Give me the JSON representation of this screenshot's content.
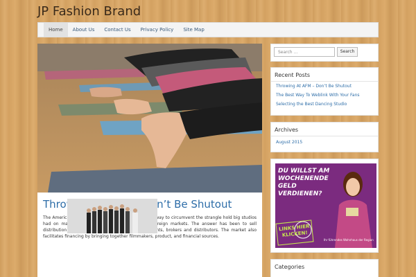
{
  "site": {
    "title": "JP Fashion Brand"
  },
  "nav": {
    "items": [
      "Home",
      "About Us",
      "Contact Us",
      "Privacy Policy",
      "Site Map"
    ],
    "active": "Home"
  },
  "post": {
    "title": "Throwing At AFM – Don’t Be Shutout",
    "body": "The American Film Market was founded in 1981 as a way to circumvent the strangle hold big studios had on marketing and distribution, especially in foreign markets. The answer has been to sell distribution rights directly to independent sales agents, brokers and distributors. The market also facilitates financing by bringing together filmmakers, product, and financial sources."
  },
  "search": {
    "placeholder": "Search …",
    "button": "Search"
  },
  "recent_posts": {
    "title": "Recent Posts",
    "items": [
      "Throwing At AFM – Don’t Be Shutout",
      "The Best Way To Weblink With Your Fans",
      "Selecting the Best Dancing Studio"
    ]
  },
  "archives": {
    "title": "Archives",
    "items": [
      "August 2015"
    ]
  },
  "ad": {
    "headline": "DU WILLST AM WOCHENENDE GELD VERDIENEN?",
    "cta": "LINKS HIER KLICKEN!",
    "logo": "Ihr führendes Wohnhaus der Region"
  },
  "categories": {
    "title": "Categories"
  },
  "colors": {
    "link": "#2d6da8",
    "background": "#d9a766",
    "ad_background": "#7b2b7f",
    "ad_accent": "#c7e84f"
  }
}
